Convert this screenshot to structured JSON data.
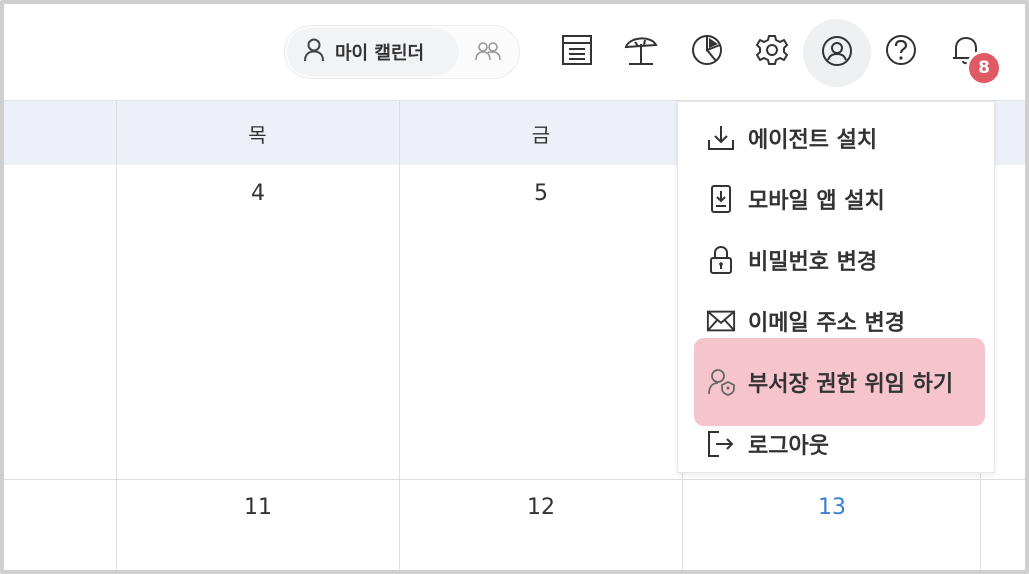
{
  "header": {
    "my_calendar_label": "마이 캘린더",
    "icons": [
      "person-icon",
      "group-icon",
      "memo-icon",
      "vacation-icon",
      "chart-icon",
      "gear-icon",
      "account-icon",
      "help-icon",
      "bell-icon"
    ],
    "notification_count": "8"
  },
  "calendar": {
    "weekday_headers": [
      "목",
      "금"
    ],
    "row1_days": [
      "4",
      "5"
    ],
    "row2_days": [
      "11",
      "12",
      "13"
    ],
    "today_color": "#3b7fd1",
    "header_bg": "#eef0f7"
  },
  "account_menu": {
    "items": [
      {
        "label": "에이전트 설치",
        "icon": "download-icon"
      },
      {
        "label": "모바일 앱 설치",
        "icon": "mobile-download-icon"
      },
      {
        "label": "비밀번호 변경",
        "icon": "lock-icon"
      },
      {
        "label": "이메일 주소 변경",
        "icon": "envelope-icon"
      },
      {
        "label": "부서장 권한 위임 하기",
        "icon": "delegate-icon"
      },
      {
        "label": "로그아웃",
        "icon": "logout-icon"
      }
    ],
    "highlight_color": "#f6c4cc",
    "highlighted_index": 4
  }
}
